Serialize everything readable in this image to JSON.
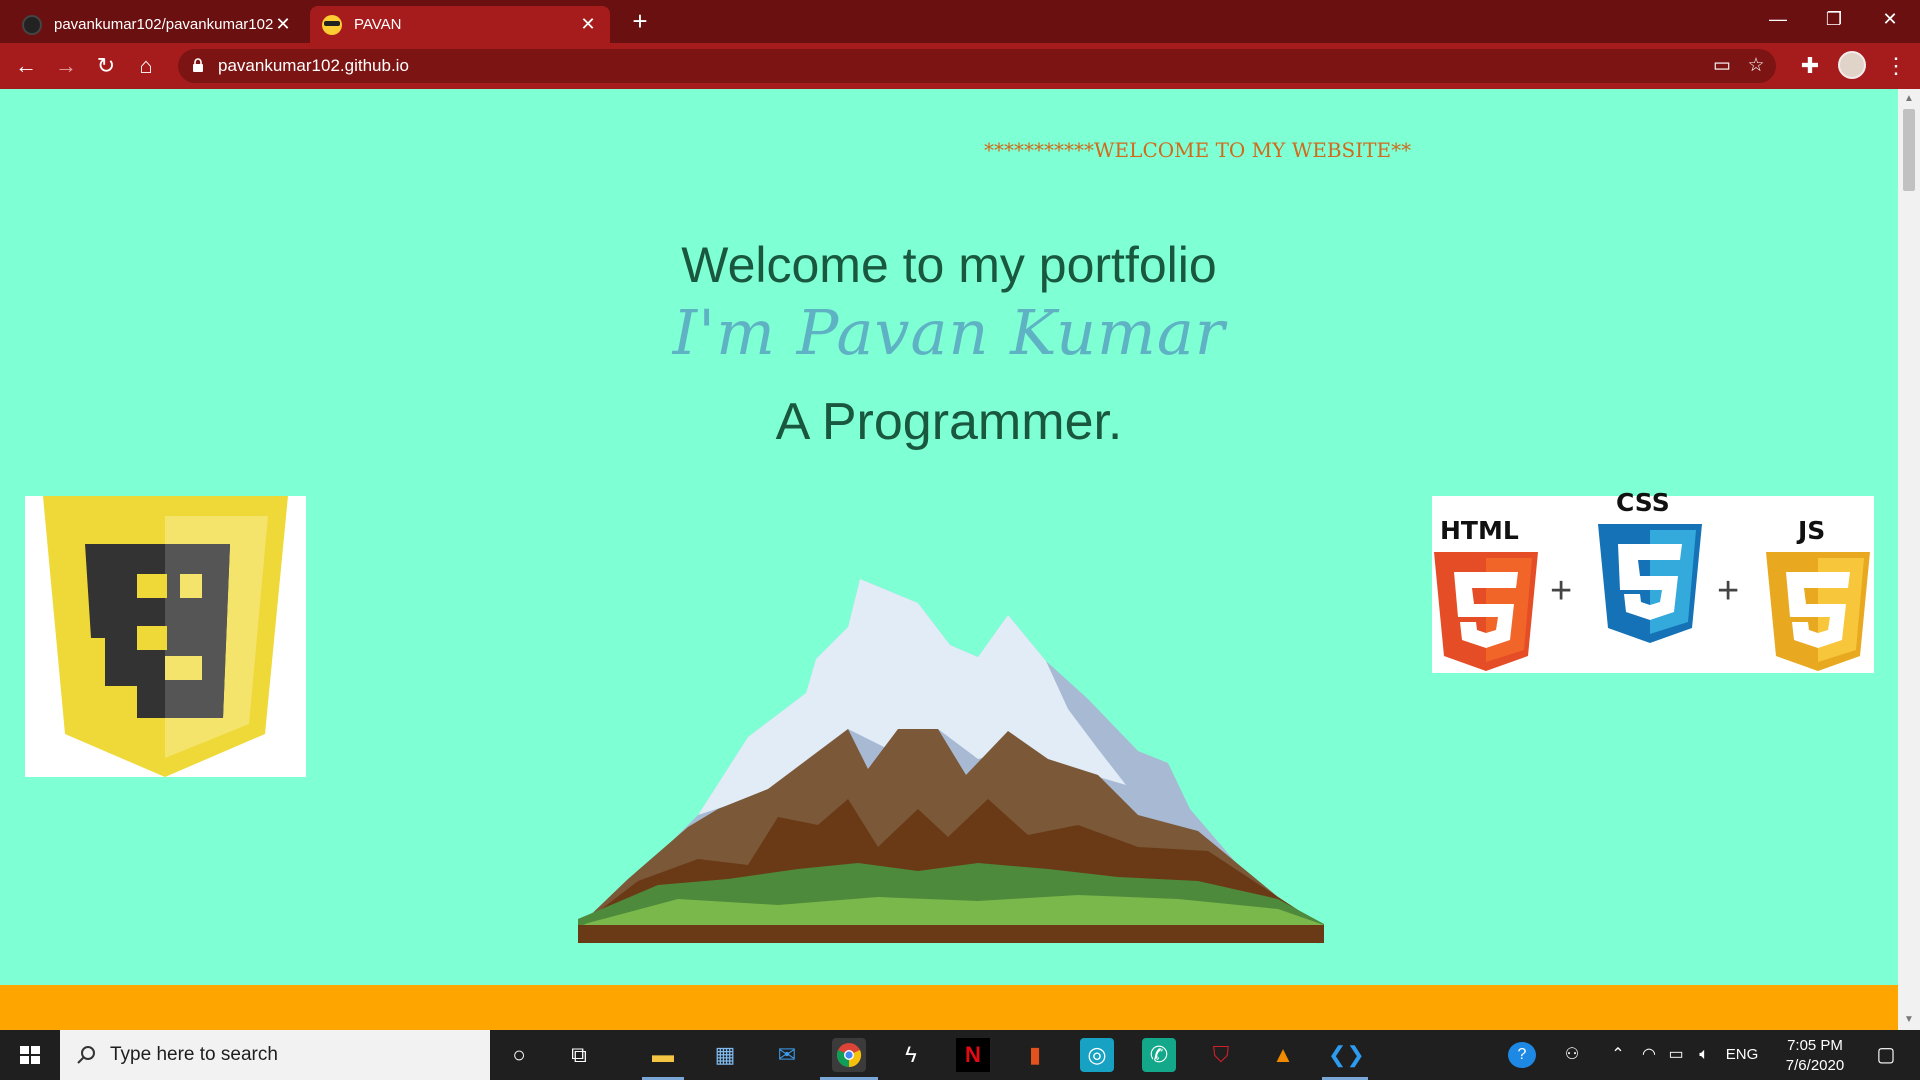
{
  "browser": {
    "tabs": [
      {
        "title": "pavankumar102/pavankumar102",
        "active": false
      },
      {
        "title": "PAVAN",
        "active": true
      }
    ],
    "url": "pavankumar102.github.io"
  },
  "page": {
    "marquee": "***********WELCOME TO MY WEBSITE**",
    "headline": "Welcome to my portfolio",
    "name_line": "I'm Pavan Kumar",
    "role_line": "A Programmer.",
    "logos": {
      "html": "HTML",
      "css": "CSS",
      "js": "JS",
      "plus": "+"
    },
    "colors": {
      "background": "#7fffd4",
      "accent": "#ffa500",
      "chrome": "#a61c1c"
    }
  },
  "taskbar": {
    "search_placeholder": "Type here to search",
    "language": "ENG",
    "time": "7:05 PM",
    "date": "7/6/2020"
  }
}
